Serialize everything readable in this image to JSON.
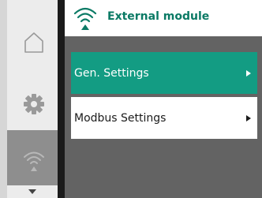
{
  "header": {
    "title": "External module",
    "icon": "wifi-module-icon"
  },
  "rail": {
    "items": [
      {
        "id": "home",
        "icon": "home-icon"
      },
      {
        "id": "settings",
        "icon": "gear-icon"
      },
      {
        "id": "external-module",
        "icon": "wifi-module-icon",
        "active": true
      }
    ],
    "scroll_icon": "chevron-down-icon"
  },
  "menu": {
    "items": [
      {
        "label": "Gen. Settings",
        "selected": true,
        "icon": "caret-right-icon"
      },
      {
        "label": "Modbus Settings",
        "selected": false,
        "icon": "caret-right-icon"
      }
    ]
  },
  "colors": {
    "accent": "#139c83",
    "title": "#0b7a65",
    "panel_bg": "#636363",
    "rail_light": "#ececec",
    "rail_dark": "#8e8e8e"
  }
}
